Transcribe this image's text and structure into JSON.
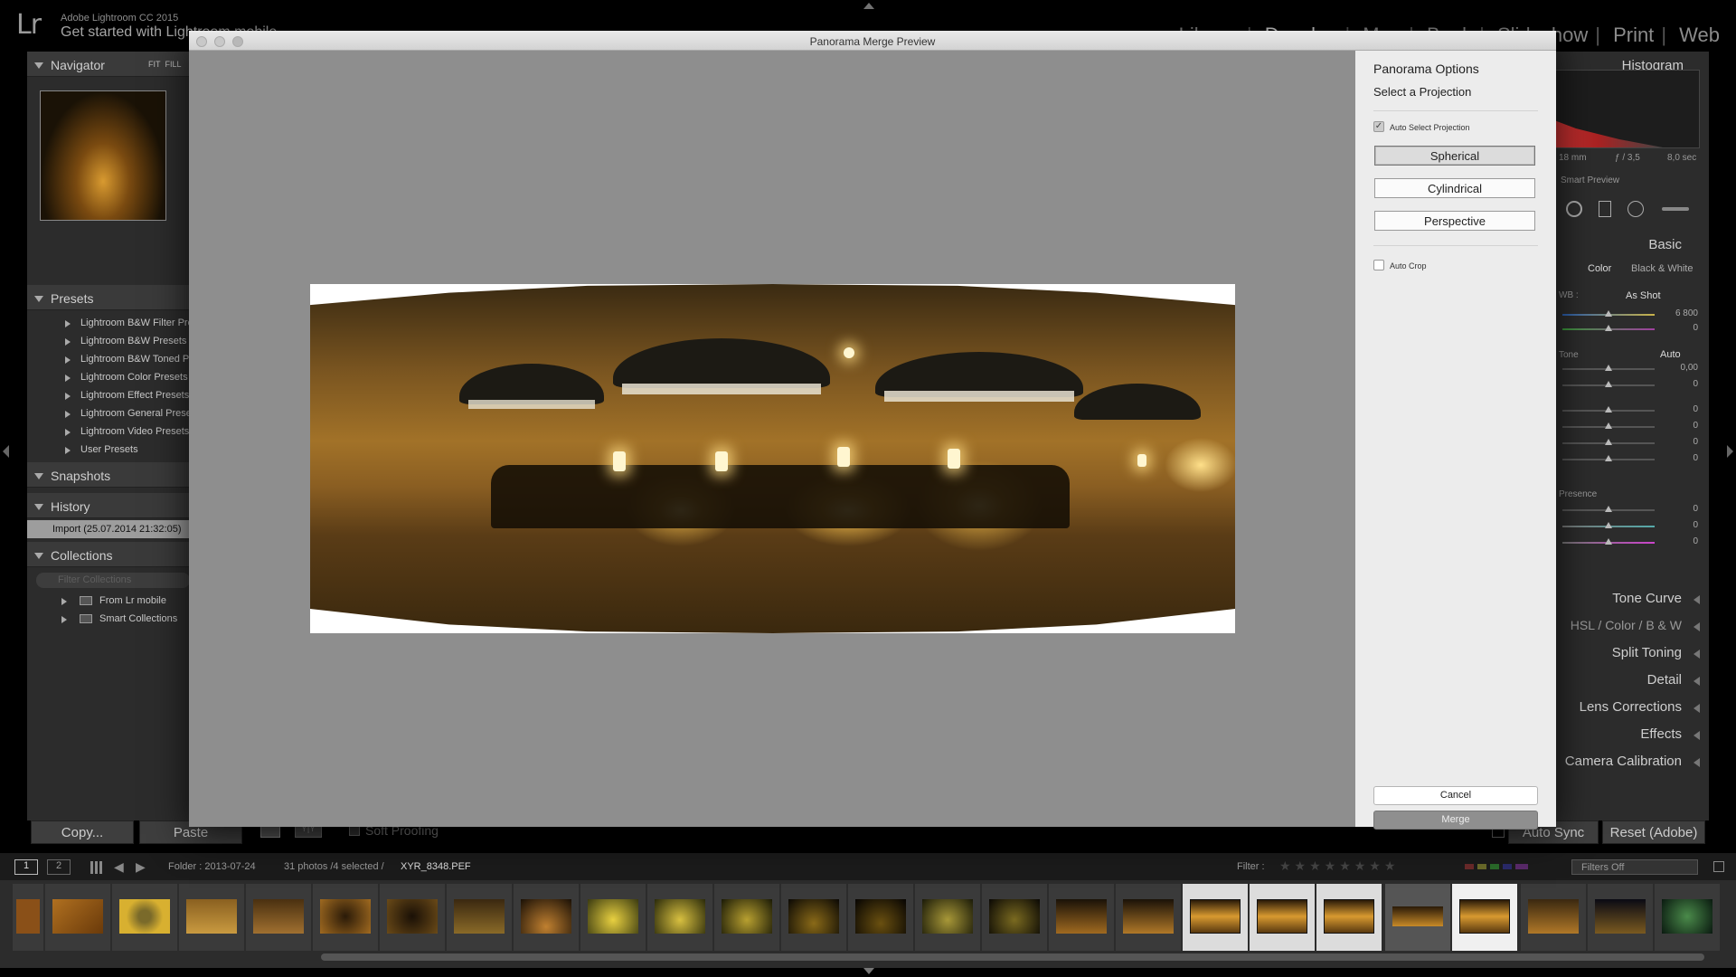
{
  "app": {
    "version": "Adobe Lightroom CC 2015",
    "mobile_prompt": "Get started with Lightroom mobile",
    "logo": "Lr"
  },
  "modules": [
    "Library",
    "Develop",
    "Map",
    "Book",
    "Slideshow",
    "Print",
    "Web"
  ],
  "left_panel": {
    "navigator": {
      "title": "Navigator",
      "fit": "FIT",
      "fill": "FILL"
    },
    "presets": {
      "title": "Presets",
      "items": [
        "Lightroom B&W Filter Presets",
        "Lightroom B&W Presets",
        "Lightroom B&W Toned Presets",
        "Lightroom Color Presets",
        "Lightroom Effect Presets",
        "Lightroom General Presets",
        "Lightroom Video Presets",
        "User Presets"
      ]
    },
    "snapshots": {
      "title": "Snapshots"
    },
    "history": {
      "title": "History",
      "items": [
        "Import (25.07.2014 21:32:05)"
      ]
    },
    "collections": {
      "title": "Collections",
      "search_placeholder": "Filter Collections",
      "items": [
        "From Lr mobile",
        "Smart Collections"
      ]
    },
    "copy_btn": "Copy...",
    "paste_btn": "Paste"
  },
  "right_panel": {
    "histogram_title": "Histogram",
    "focal": "18 mm",
    "aperture": "ƒ / 3,5",
    "shutter": "8,0 sec",
    "smart_preview": "Smart Preview",
    "basic_title": "Basic",
    "treatment_color": "Color",
    "treatment_bw": "Black & White",
    "wb_label": "WB :",
    "wb_value": "As Shot",
    "temp_value": "6 800",
    "tint_value": "0",
    "tone_label": "Tone",
    "tone_auto": "Auto",
    "exposure_value": "0,00",
    "tone_values": [
      "0",
      "0",
      "0",
      "0",
      "0"
    ],
    "presence_label": "Presence",
    "presence_values": [
      "0",
      "0",
      "0"
    ],
    "sections": [
      "Tone Curve",
      "Split Toning",
      "Detail",
      "Lens Corrections",
      "Effects",
      "Camera Calibration"
    ],
    "hsl": {
      "hsl": "HSL",
      "color": "Color",
      "bw": "B & W"
    },
    "auto_sync_btn": "Auto Sync",
    "reset_btn": "Reset (Adobe)"
  },
  "toolbar": {
    "soft_proofing": "Soft Proofing"
  },
  "filmstrip_bar": {
    "page1": "1",
    "page2": "2",
    "folder": "Folder : 2013-07-24",
    "count": "31 photos /4 selected /",
    "filename": "XYR_8348.PEF",
    "filter_label": "Filter :",
    "filters_off": "Filters Off"
  },
  "dialog": {
    "title": "Panorama Merge Preview",
    "options_title": "Panorama Options",
    "select_projection": "Select a Projection",
    "auto_select_label": "Auto Select Projection",
    "auto_select_checked": true,
    "projections": [
      "Spherical",
      "Cylindrical",
      "Perspective"
    ],
    "selected_projection": "Spherical",
    "auto_crop_label": "Auto Crop",
    "auto_crop_checked": false,
    "cancel_btn": "Cancel",
    "merge_btn": "Merge"
  }
}
